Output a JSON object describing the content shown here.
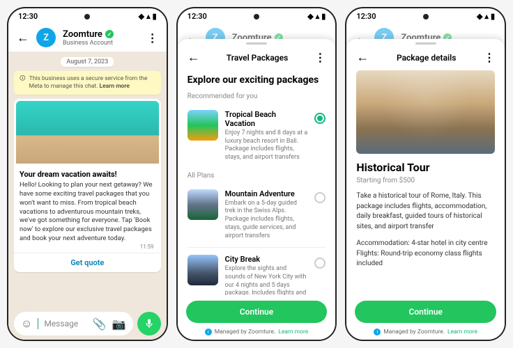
{
  "status": {
    "time": "12:30"
  },
  "business": {
    "name": "Zoomture",
    "subtitle": "Business Account",
    "initial": "Z"
  },
  "chat": {
    "date": "August 7, 2023",
    "secure_notice": "This business uses a secure service from the Meta to manage this chat.",
    "learn_more": "Learn more",
    "headline": "Your dream vacation awaits!",
    "body": "Hello! Looking to plan your next getaway? We have some exciting travel packages that you won't want to miss. From tropical beach vacations to adventurous mountain treks, we've got something for everyone. Tap 'Book now' to explore our exclusive travel packages and book your next adventure today.",
    "time": "11:59",
    "cta": "Get quote",
    "placeholder": "Message"
  },
  "packages": {
    "sheet_title": "Travel Packages",
    "heading": "Explore our exciting packages",
    "section_recommended": "Recommended for you",
    "section_all": "All Plans",
    "continue": "Continue",
    "managed_prefix": "Managed by Zoomture.",
    "managed_learn": "Learn more",
    "items": [
      {
        "title": "Tropical Beach Vacation",
        "desc": "Enjoy 7 nights and 8 days at a luxury beach resort in Bali. Package includes flights, stays, and airport transfers"
      },
      {
        "title": "Mountain Adventure",
        "desc": "Embark on a 5-day guided trek in the Swiss Alps. Package includes flights, stays, guide services, and airport transfers"
      },
      {
        "title": "City Break",
        "desc": "Explore the sights and sounds of New York City with our 4 nights and 5 days package. Includes flights and stays"
      }
    ]
  },
  "details": {
    "sheet_title": "Package details",
    "title": "Historical Tour",
    "price": "Starting from $500",
    "desc": "Take a historical tour of Rome, Italy. This package includes flights, accommodation, daily breakfast, guided tours of historical sites, and airport transfer",
    "extra": "Accommodation: 4-star hotel in city centre Flights: Round-trip economy class flights included",
    "continue": "Continue"
  }
}
